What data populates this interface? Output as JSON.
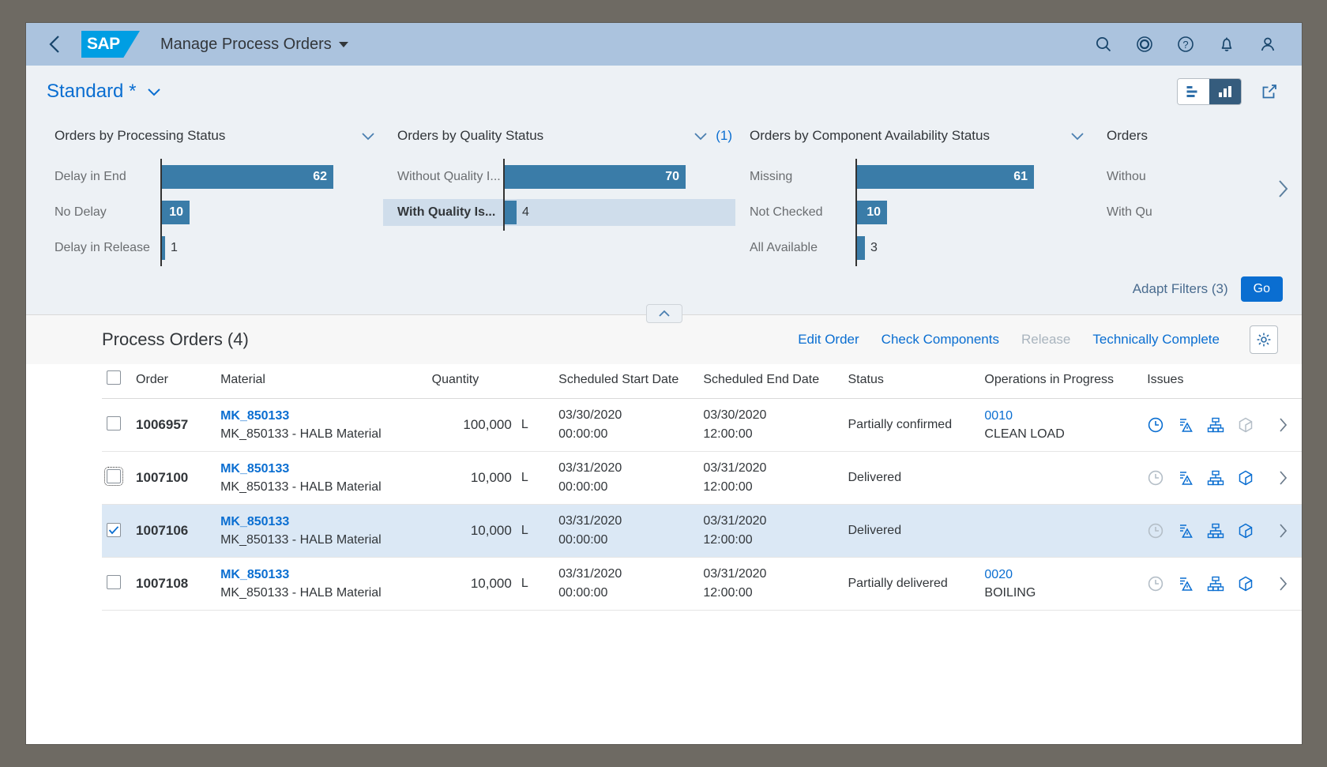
{
  "shell": {
    "back_icon": "chevron-left-icon",
    "logo_text": "SAP",
    "app_title": "Manage Process Orders",
    "icons": [
      "search-icon",
      "target-icon",
      "help-icon",
      "bell-icon",
      "user-icon"
    ]
  },
  "filterbar": {
    "variant_label": "Standard *",
    "view_list_icon": "list-view-icon",
    "view_chart_icon": "chart-view-icon",
    "share_icon": "share-icon",
    "adapt_filters_label": "Adapt Filters (3)",
    "go_label": "Go",
    "scroll_right_icon": "chevron-right-icon",
    "collapse_icon": "chevron-up-icon"
  },
  "chart_data": [
    {
      "type": "bar",
      "title": "Orders by Processing Status",
      "orientation": "horizontal",
      "categories": [
        "Delay in End",
        "No Delay",
        "Delay in Release"
      ],
      "values": [
        62,
        10,
        1
      ],
      "selected": [],
      "xlabel": "",
      "ylabel": "",
      "xlim": [
        0,
        62
      ],
      "grid": false,
      "legend": false,
      "count_badge": ""
    },
    {
      "type": "bar",
      "title": "Orders by Quality Status",
      "orientation": "horizontal",
      "categories": [
        "Without Quality I...",
        "With Quality Is..."
      ],
      "values": [
        70,
        4
      ],
      "selected": [
        "With Quality Is..."
      ],
      "xlabel": "",
      "ylabel": "",
      "xlim": [
        0,
        70
      ],
      "grid": false,
      "legend": false,
      "count_badge": "(1)"
    },
    {
      "type": "bar",
      "title": "Orders by Component Availability Status",
      "orientation": "horizontal",
      "categories": [
        "Missing",
        "Not Checked",
        "All Available"
      ],
      "values": [
        61,
        10,
        3
      ],
      "selected": [],
      "xlabel": "",
      "ylabel": "",
      "xlim": [
        0,
        61
      ],
      "grid": false,
      "legend": false,
      "count_badge": ""
    },
    {
      "type": "bar",
      "title": "Orders",
      "orientation": "horizontal",
      "categories": [
        "Withou",
        "With Qu"
      ],
      "values": [
        0,
        0
      ],
      "selected": [],
      "xlabel": "",
      "ylabel": "",
      "xlim": [
        0,
        1
      ],
      "grid": false,
      "legend": false,
      "count_badge": "",
      "truncated": true
    }
  ],
  "table": {
    "title": "Process Orders (4)",
    "actions": [
      {
        "label": "Edit Order",
        "disabled": false
      },
      {
        "label": "Check Components",
        "disabled": false
      },
      {
        "label": "Release",
        "disabled": true
      },
      {
        "label": "Technically Complete",
        "disabled": false
      }
    ],
    "settings_icon": "gear-icon",
    "columns": [
      "Order",
      "Material",
      "Quantity",
      "Scheduled Start Date",
      "Scheduled End Date",
      "Status",
      "Operations in Progress",
      "Issues"
    ],
    "rows": [
      {
        "order": "1006957",
        "material_link": "MK_850133",
        "material_desc": "MK_850133 - HALB Material",
        "quantity": "100,000",
        "uom": "L",
        "start_date_d": "03/30/2020",
        "start_date_t": "00:00:00",
        "end_date_d": "03/30/2020",
        "end_date_t": "12:00:00",
        "status": "Partially confirmed",
        "op_number": "0010",
        "op_name": "CLEAN LOAD",
        "issue_icons": [
          "clock-icon",
          "document-warning-icon",
          "org-chart-icon",
          "package-icon"
        ],
        "issue_icon_states": [
          "active",
          "active",
          "active",
          "inactive"
        ],
        "checked": false,
        "focused": false,
        "selected": false
      },
      {
        "order": "1007100",
        "material_link": "MK_850133",
        "material_desc": "MK_850133 - HALB Material",
        "quantity": "10,000",
        "uom": "L",
        "start_date_d": "03/31/2020",
        "start_date_t": "00:00:00",
        "end_date_d": "03/31/2020",
        "end_date_t": "12:00:00",
        "status": "Delivered",
        "op_number": "",
        "op_name": "",
        "issue_icons": [
          "clock-icon",
          "document-warning-icon",
          "org-chart-icon",
          "package-icon"
        ],
        "issue_icon_states": [
          "inactive",
          "active",
          "active",
          "active"
        ],
        "checked": false,
        "focused": true,
        "selected": false
      },
      {
        "order": "1007106",
        "material_link": "MK_850133",
        "material_desc": "MK_850133 - HALB Material",
        "quantity": "10,000",
        "uom": "L",
        "start_date_d": "03/31/2020",
        "start_date_t": "00:00:00",
        "end_date_d": "03/31/2020",
        "end_date_t": "12:00:00",
        "status": "Delivered",
        "op_number": "",
        "op_name": "",
        "issue_icons": [
          "clock-icon",
          "document-warning-icon",
          "org-chart-icon",
          "package-icon"
        ],
        "issue_icon_states": [
          "inactive",
          "active",
          "active",
          "active"
        ],
        "checked": true,
        "focused": false,
        "selected": true
      },
      {
        "order": "1007108",
        "material_link": "MK_850133",
        "material_desc": "MK_850133 - HALB Material",
        "quantity": "10,000",
        "uom": "L",
        "start_date_d": "03/31/2020",
        "start_date_t": "00:00:00",
        "end_date_d": "03/31/2020",
        "end_date_t": "12:00:00",
        "status": "Partially delivered",
        "op_number": "0020",
        "op_name": "BOILING",
        "issue_icons": [
          "clock-icon",
          "document-warning-icon",
          "org-chart-icon",
          "package-icon"
        ],
        "issue_icon_states": [
          "inactive",
          "active",
          "active",
          "active"
        ],
        "checked": false,
        "focused": false,
        "selected": false
      }
    ],
    "row_nav_icon": "chevron-right-icon"
  },
  "colors": {
    "accent": "#0a6ed1",
    "bar": "#3a7ca8",
    "shell_bg": "#abc3de",
    "selected_row": "#dbe8f5"
  }
}
